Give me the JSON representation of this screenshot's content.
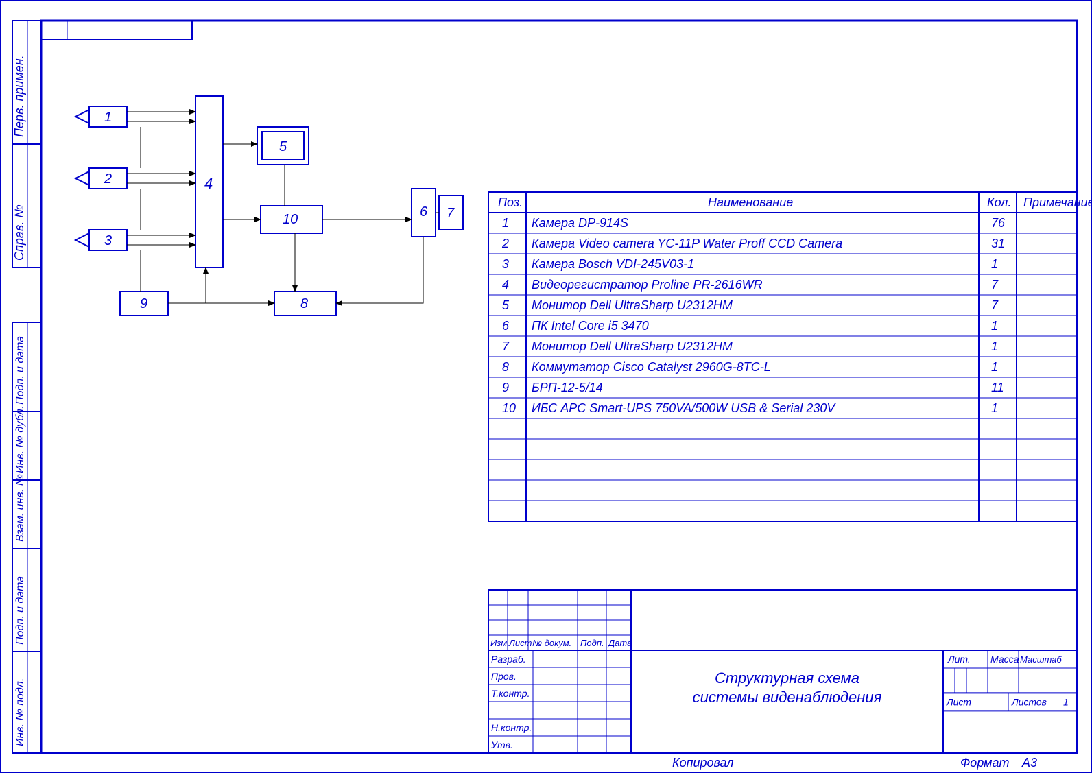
{
  "frame": {
    "side_labels": [
      "Перв. примен.",
      "Справ. №",
      "Подп. и дата",
      "Инв. № дубл.",
      "Взам. инв. №",
      "Подп. и дата",
      "Инв. № подл."
    ],
    "footer_copy": "Копировал",
    "footer_format_label": "Формат",
    "footer_format_value": "А3"
  },
  "title_block": {
    "headers": {
      "izm": "Изм.",
      "list": "Лист",
      "doc": "№ докум.",
      "sign": "Подп.",
      "date": "Дата"
    },
    "rows": [
      "Разраб.",
      "Пров.",
      "Т.контр.",
      "Н.контр.",
      "Утв."
    ],
    "title_line1": "Структурная схема",
    "title_line2": "системы виденаблюдения",
    "lit": "Лит.",
    "mass": "Масса",
    "scale": "Масштаб",
    "sheet": "Лист",
    "sheets": "Листов",
    "sheets_val": "1"
  },
  "parts_table": {
    "head": {
      "pos": "Поз.",
      "name": "Наименование",
      "qty": "Кол.",
      "note": "Примечание"
    },
    "rows": [
      {
        "pos": "1",
        "name": "Камера DP-914S",
        "qty": "76",
        "note": ""
      },
      {
        "pos": "2",
        "name": "Камера Video camera YC-11P Water Proff CCD Camera",
        "qty": "31",
        "note": ""
      },
      {
        "pos": "3",
        "name": "Камера Bosch VDI-245V03-1",
        "qty": "1",
        "note": ""
      },
      {
        "pos": "4",
        "name": "Видеорегистратор Proline PR-2616WR",
        "qty": "7",
        "note": ""
      },
      {
        "pos": "5",
        "name": "Монитор Dell UltraSharp U2312HM",
        "qty": "7",
        "note": ""
      },
      {
        "pos": "6",
        "name": "ПК Intel Core i5 3470",
        "qty": "1",
        "note": ""
      },
      {
        "pos": "7",
        "name": "Монитор Dell UltraSharp U2312HM",
        "qty": "1",
        "note": ""
      },
      {
        "pos": "8",
        "name": "Коммутатор Cisco Catalyst 2960G-8TC-L",
        "qty": "1",
        "note": ""
      },
      {
        "pos": "9",
        "name": "БРП-12-5/14",
        "qty": "11",
        "note": ""
      },
      {
        "pos": "10",
        "name": "ИБС APC Smart-UPS 750VA/500W USB & Serial 230V",
        "qty": "1",
        "note": ""
      }
    ],
    "empty_rows": 5
  },
  "diagram": {
    "blocks": {
      "b1": "1",
      "b2": "2",
      "b3": "3",
      "b4": "4",
      "b5": "5",
      "b6": "6",
      "b7": "7",
      "b8": "8",
      "b9": "9",
      "b10": "10"
    }
  }
}
